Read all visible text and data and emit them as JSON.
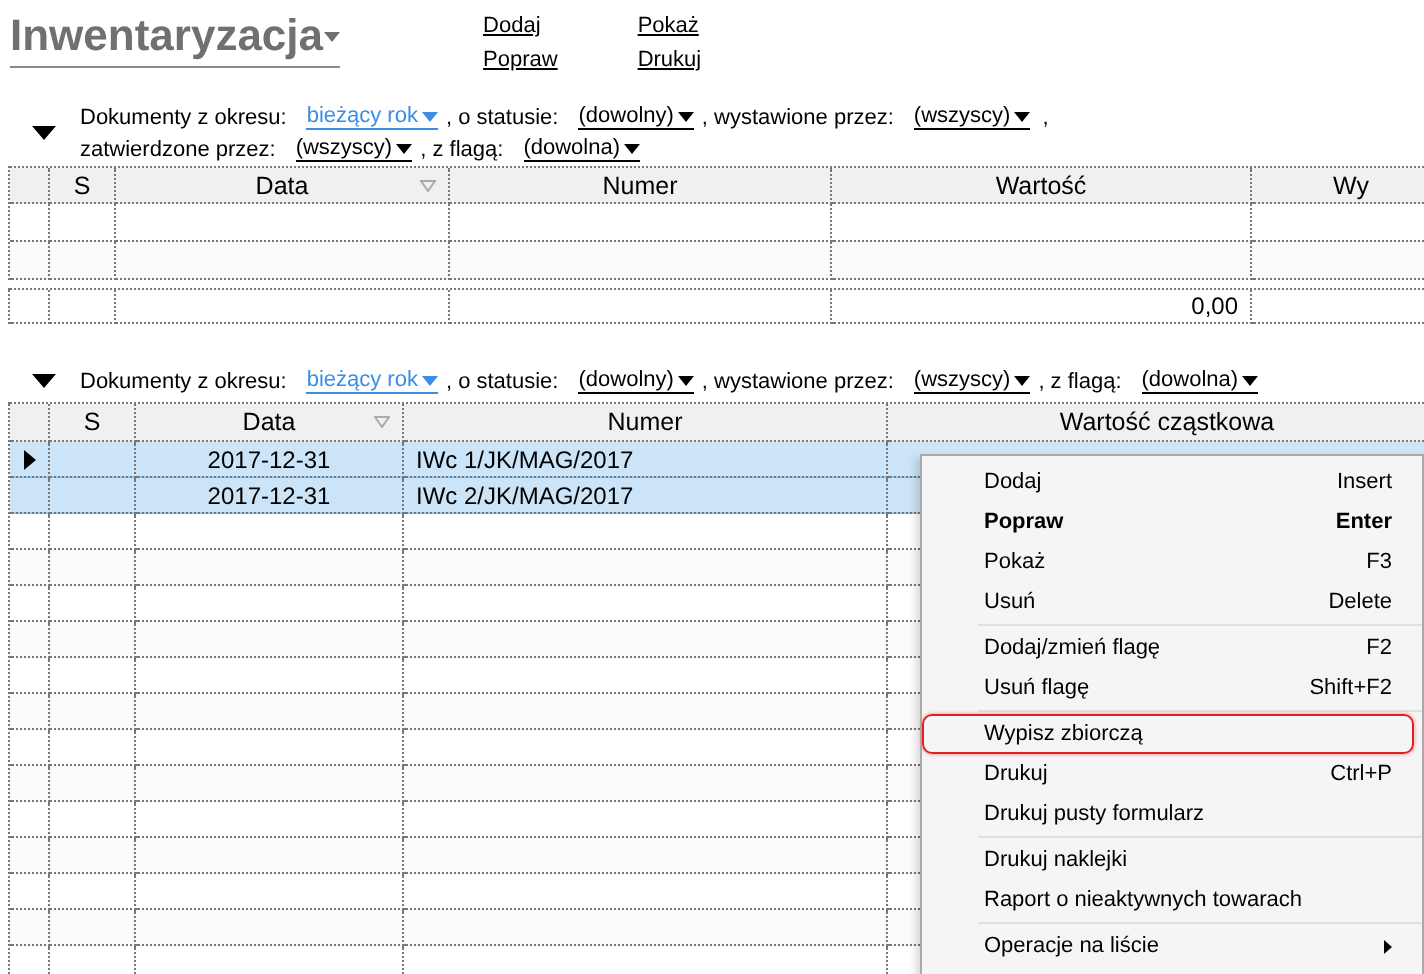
{
  "header": {
    "title": "Inwentaryzacja",
    "actions": [
      [
        "Dodaj",
        "Popraw"
      ],
      [
        "Pokaż",
        "Drukuj"
      ]
    ]
  },
  "top_list": {
    "expanded": true,
    "filter_lines": [
      [
        {
          "label": "Dokumenty z okresu:",
          "value": "bieżący rok",
          "kind": "period"
        },
        {
          "label": ", o statusie:",
          "value": "(dowolny)",
          "kind": "choice"
        },
        {
          "label": ", wystawione przez:",
          "value": "(wszyscy)",
          "kind": "choice",
          "trailing": ","
        }
      ],
      [
        {
          "label": "zatwierdzone przez:",
          "value": "(wszyscy)",
          "kind": "choice"
        },
        {
          "label": ", z flagą:",
          "value": "(dowolna)",
          "kind": "choice"
        }
      ]
    ],
    "columns": [
      {
        "title": "S"
      },
      {
        "title": "Data",
        "filter_icon": true
      },
      {
        "title": "Numer"
      },
      {
        "title": "Wartość",
        "total": "0,00"
      },
      {
        "title": "Wy"
      }
    ]
  },
  "bottom_list": {
    "expanded": true,
    "filter_lines": [
      [
        {
          "label": "Dokumenty z okresu:",
          "value": "bieżący rok",
          "kind": "period"
        },
        {
          "label": ", o statusie:",
          "value": "(dowolny)",
          "kind": "choice"
        },
        {
          "label": ", wystawione przez:",
          "value": "(wszyscy)",
          "kind": "choice"
        },
        {
          "label": ", z flagą:",
          "value": "(dowolna)",
          "kind": "choice"
        }
      ]
    ],
    "columns": [
      {
        "title": "S"
      },
      {
        "title": "Data",
        "filter_icon": true
      },
      {
        "title": "Numer"
      },
      {
        "title": "Wartość cząstkowa"
      }
    ],
    "rows": [
      {
        "cells": [
          "",
          "2017-12-31",
          "IWc 1/JK/MAG/2017"
        ],
        "selected": true,
        "current": true
      },
      {
        "cells": [
          "",
          "2017-12-31",
          "IWc 2/JK/MAG/2017"
        ],
        "selected": true,
        "current": false
      }
    ]
  },
  "context_menu": {
    "groups": [
      [
        {
          "label": "Dodaj",
          "shortcut": "Insert",
          "default": false,
          "highlighted": false
        },
        {
          "label": "Popraw",
          "shortcut": "Enter",
          "default": true,
          "highlighted": false
        },
        {
          "label": "Pokaż",
          "shortcut": "F3",
          "default": false,
          "highlighted": false
        },
        {
          "label": "Usuń",
          "shortcut": "Delete",
          "default": false,
          "highlighted": false
        }
      ],
      [
        {
          "label": "Dodaj/zmień flagę",
          "shortcut": "F2",
          "default": false,
          "highlighted": false
        },
        {
          "label": "Usuń flagę",
          "shortcut": "Shift+F2",
          "default": false,
          "highlighted": false
        }
      ],
      [
        {
          "label": "Wypisz zbiorczą",
          "default": false,
          "highlighted": true
        },
        {
          "label": "Drukuj",
          "shortcut": "Ctrl+P",
          "default": false,
          "highlighted": false
        },
        {
          "label": "Drukuj pusty formularz",
          "default": false,
          "highlighted": false
        }
      ],
      [
        {
          "label": "Drukuj naklejki",
          "default": false,
          "highlighted": false
        },
        {
          "label": "Raport o nieaktywnych towarach",
          "default": false,
          "highlighted": false
        }
      ],
      [
        {
          "label": "Operacje na liście",
          "submenu": true,
          "default": false,
          "highlighted": false
        }
      ]
    ]
  }
}
